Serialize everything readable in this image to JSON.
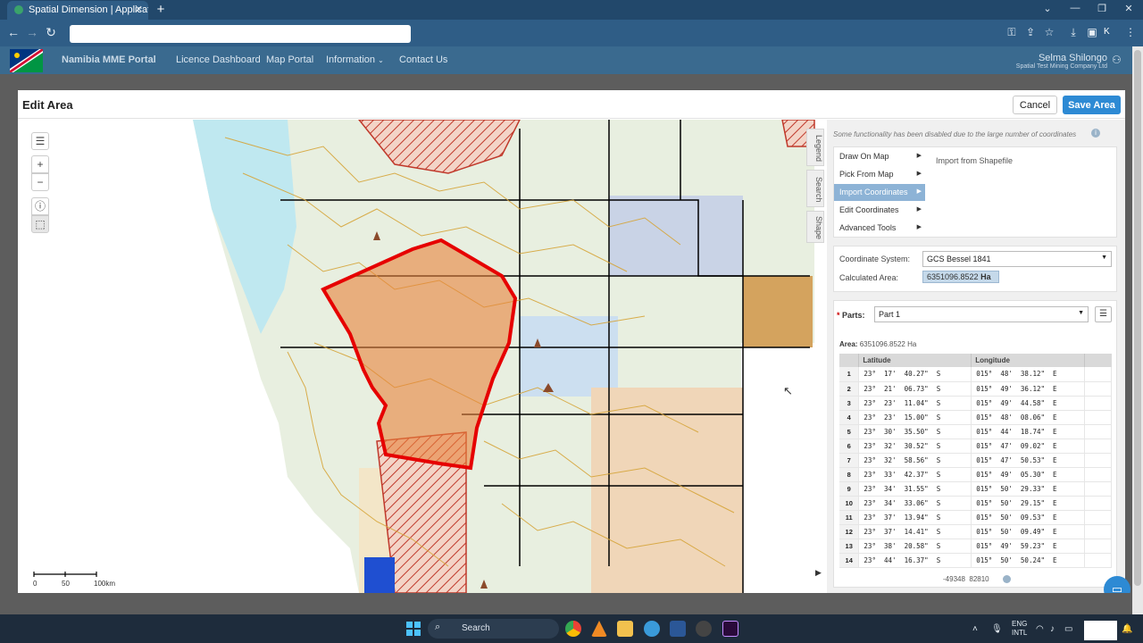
{
  "browser": {
    "tab_title": "Spatial Dimension | Application",
    "tab_close": "✕",
    "new_tab": "+",
    "profile_initial": "K",
    "window_controls": [
      "⌄",
      "—",
      "❐",
      "✕"
    ]
  },
  "header": {
    "brand": "Namibia MME Portal",
    "nav": [
      "Licence Dashboard",
      "Map Portal",
      "Information",
      "Contact Us"
    ],
    "user_name": "Selma Shilongo",
    "company": "Spatial Test Mining Company Ltd"
  },
  "modal": {
    "title": "Edit Area",
    "cancel_label": "Cancel",
    "save_label": "Save Area"
  },
  "map": {
    "side_tabs": [
      "Legend",
      "Search",
      "Shape"
    ],
    "scale_labels": [
      "0",
      "50",
      "100km"
    ],
    "controls": [
      "layers-icon",
      "zoom-in-icon",
      "zoom-out-icon",
      "info-icon",
      "select-icon"
    ]
  },
  "panel": {
    "warning": "Some functionality has been disabled due to the large number of coordinates",
    "menu": [
      "Draw On Map",
      "Pick From Map",
      "Import Coordinates",
      "Edit Coordinates",
      "Advanced Tools"
    ],
    "selected_menu": "Import Coordinates",
    "submenu_item": "Import from Shapefile",
    "coord_system_label": "Coordinate System:",
    "coord_system_value": "GCS Bessel 1841",
    "calc_area_label": "Calculated Area:",
    "calc_area_value": "6351096.8522",
    "calc_area_unit": "Ha",
    "parts_label": "Parts:",
    "parts_value": "Part 1",
    "area_label": "Area:",
    "area_value": "6351096.8522 Ha",
    "columns": [
      "Latitude",
      "Longitude"
    ],
    "rows": [
      [
        "1",
        "23°  17'  40.27\"  S",
        "015°  48'  38.12\"  E"
      ],
      [
        "2",
        "23°  21'  06.73\"  S",
        "015°  49'  36.12\"  E"
      ],
      [
        "3",
        "23°  23'  11.04\"  S",
        "015°  49'  44.58\"  E"
      ],
      [
        "4",
        "23°  23'  15.00\"  S",
        "015°  48'  08.06\"  E"
      ],
      [
        "5",
        "23°  30'  35.50\"  S",
        "015°  44'  18.74\"  E"
      ],
      [
        "6",
        "23°  32'  30.52\"  S",
        "015°  47'  09.02\"  E"
      ],
      [
        "7",
        "23°  32'  58.56\"  S",
        "015°  47'  50.53\"  E"
      ],
      [
        "8",
        "23°  33'  42.37\"  S",
        "015°  49'  05.30\"  E"
      ],
      [
        "9",
        "23°  34'  31.55\"  S",
        "015°  50'  29.33\"  E"
      ],
      [
        "10",
        "23°  34'  33.06\"  S",
        "015°  50'  29.15\"  E"
      ],
      [
        "11",
        "23°  37'  13.94\"  S",
        "015°  50'  09.53\"  E"
      ],
      [
        "12",
        "23°  37'  14.41\"  S",
        "015°  50'  09.49\"  E"
      ],
      [
        "13",
        "23°  38'  20.58\"  S",
        "015°  49'  59.23\"  E"
      ],
      [
        "14",
        "23°  44'  16.37\"  S",
        "015°  50'  50.24\"  E"
      ]
    ],
    "status_x": "-49348",
    "status_y": "82810"
  },
  "taskbar": {
    "search_label": "Search",
    "lang_line1": "ENG",
    "lang_line2": "INTL"
  }
}
